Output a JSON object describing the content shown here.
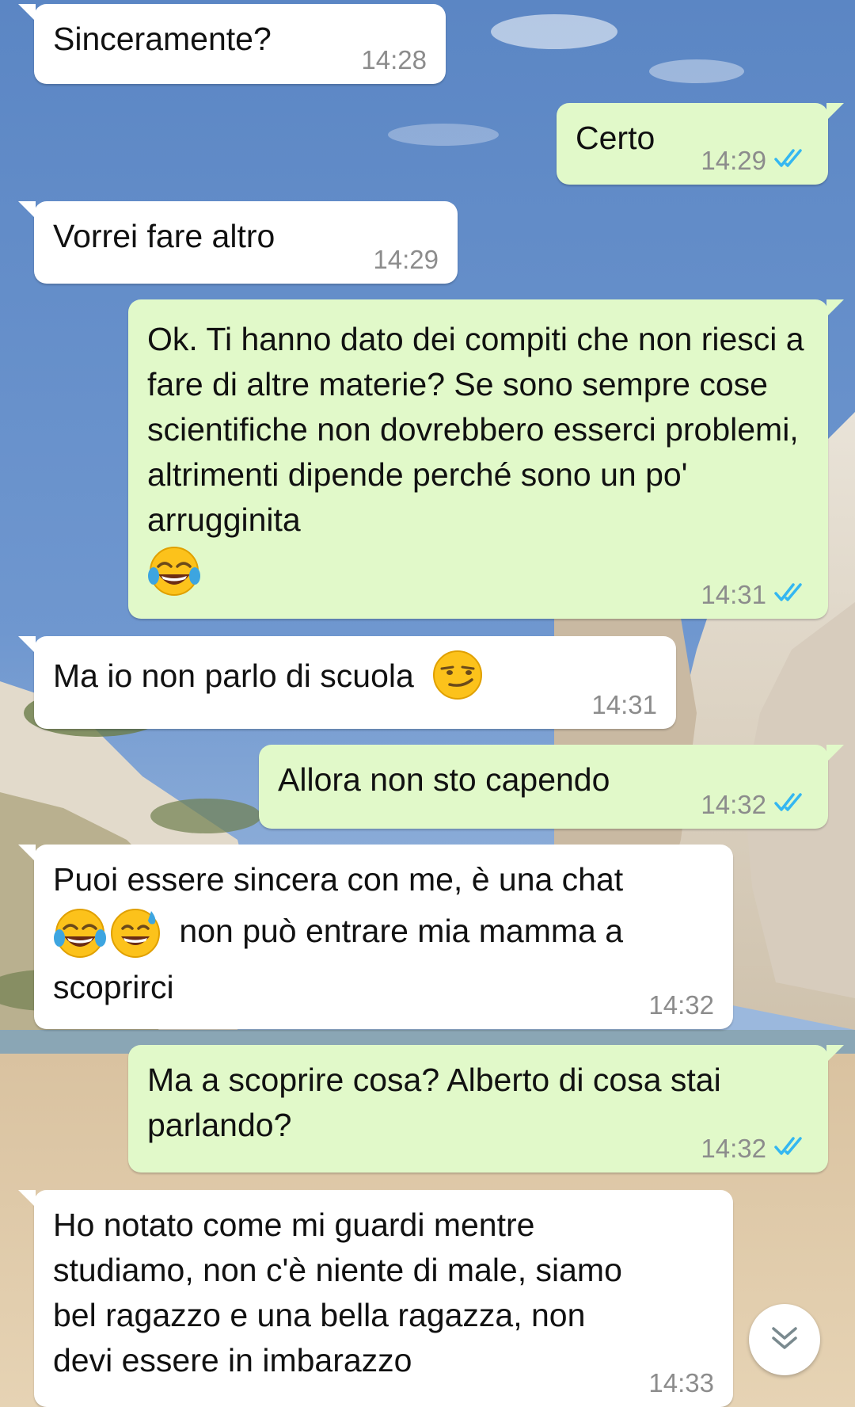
{
  "colors": {
    "incoming_bubble": "#ffffff",
    "outgoing_bubble": "#e1f9c9",
    "timestamp": "#8c8c8c",
    "read_ticks": "#34b7f1"
  },
  "messages": [
    {
      "direction": "in",
      "text": "Sinceramente?",
      "time": "14:28"
    },
    {
      "direction": "out",
      "text": "Certo",
      "time": "14:29",
      "status": "read"
    },
    {
      "direction": "in",
      "text": "Vorrei fare altro",
      "time": "14:29"
    },
    {
      "direction": "out",
      "text": "Ok. Ti hanno dato dei compiti che non riesci a fare di altre materie? Se sono sempre cose scientifiche non dovrebbero esserci problemi, altrimenti dipende perché sono un po' arrugginita",
      "emoji": "face-with-tears-of-joy",
      "time": "14:31",
      "status": "read"
    },
    {
      "direction": "in",
      "text": "Ma io non parlo di scuola",
      "emoji": "smirking-face",
      "time": "14:31"
    },
    {
      "direction": "out",
      "text": "Allora non sto capendo",
      "time": "14:32",
      "status": "read"
    },
    {
      "direction": "in",
      "text_before_emoji": "Puoi essere sincera con me, è una chat",
      "emojis": [
        "face-with-tears-of-joy",
        "grinning-face-with-sweat"
      ],
      "text_after_emoji": "non può entrare mia mamma a scoprirci",
      "time": "14:32"
    },
    {
      "direction": "out",
      "text": "Ma a scoprire cosa? Alberto di cosa stai parlando?",
      "time": "14:32",
      "status": "read"
    },
    {
      "direction": "in",
      "text": "Ho notato come mi guardi mentre studiamo, non c'è niente di male, siamo bel ragazzo e una bella ragazza, non devi essere in imbarazzo",
      "time": "14:33"
    }
  ],
  "scroll_button": {
    "icon": "double-chevron-down-icon"
  }
}
